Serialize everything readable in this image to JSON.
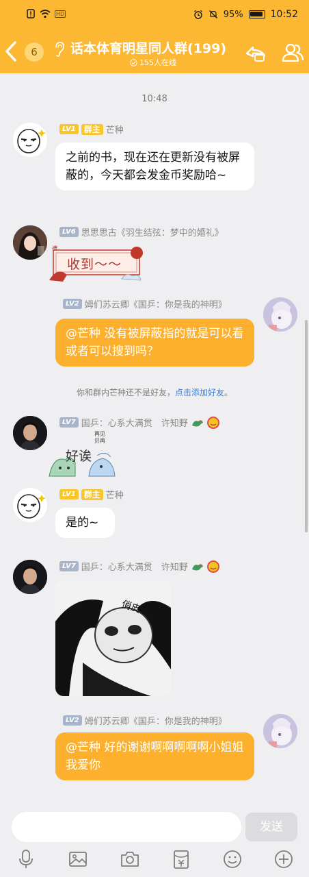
{
  "status": {
    "battery": "95%",
    "time": "10:52",
    "network": "HD"
  },
  "header": {
    "unread_count": "6",
    "title": "话本体育明星同人群(199)",
    "online": "155人在线"
  },
  "chat": {
    "time": "10:48",
    "messages": [
      {
        "level": "LV1",
        "role": "群主",
        "name": "芒种",
        "text": "之前的书，现在还在更新没有被屏蔽的，今天都会发金币奖励哈~"
      },
      {
        "level": "LV6",
        "name": "思思思古《羽生结弦：梦中的婚礼》",
        "sticker_text": "收到～～"
      },
      {
        "level": "LV2",
        "name": "姆们苏云卿《国乒：你是我的神明》",
        "text": "@芒种 没有被屏蔽指的就是可以看或者可以搜到吗？"
      },
      {
        "level": "LV7",
        "name": "国乒：心系大满贯　许知野",
        "sticker_text": "好诶",
        "sticker_small": "再见\n贝再"
      },
      {
        "level": "LV1",
        "role": "群主",
        "name": "芒种",
        "text": "是的~"
      },
      {
        "level": "LV7",
        "name": "国乒：心系大满贯　许知野",
        "sticker_text": "俏皮"
      },
      {
        "level": "LV2",
        "name": "姆们苏云卿《国乒：你是我的神明》",
        "text": "@芒种 好的谢谢啊啊啊啊啊小姐姐我爱你"
      }
    ],
    "system": {
      "text": "你和群内芒种还不是好友，",
      "link": "点击添加好友",
      "end": "。"
    }
  },
  "input": {
    "placeholder": "",
    "send_label": "发送"
  },
  "colors": {
    "accent": "#fdb833",
    "bubble_out": "#fcb02e",
    "link": "#3b7ed4"
  }
}
